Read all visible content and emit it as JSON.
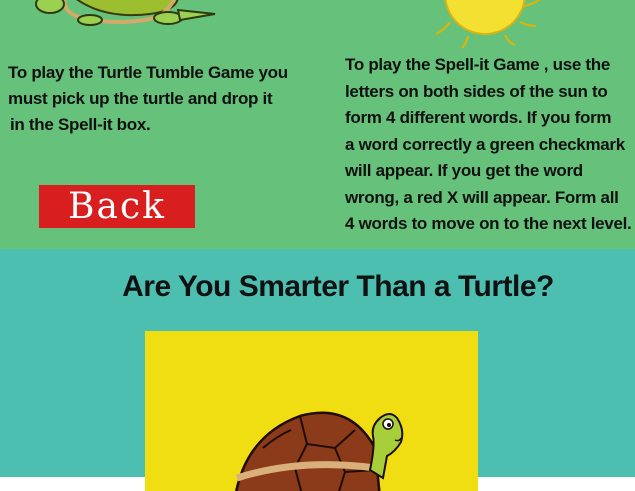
{
  "turtle_instructions": [
    "To play the Turtle Tumble Game you",
    "must pick up the turtle and drop it",
    "in the Spell-it box."
  ],
  "spell_instructions": [
    "To play the Spell-it Game , use the",
    "letters on both sides of the sun to",
    "form 4 different words. If you form",
    "a word correctly a green checkmark",
    "will appear. If you get the word",
    "wrong, a red X will appear. Form all",
    "4 words to move on to the next level."
  ],
  "back_label": "Back",
  "title": "Are You Smarter Than a Turtle?",
  "colors": {
    "top_bg": "#66c27a",
    "bottom_bg": "#4dbfb1",
    "back_bg": "#d81e1e",
    "box_bg": "#f1de12"
  }
}
